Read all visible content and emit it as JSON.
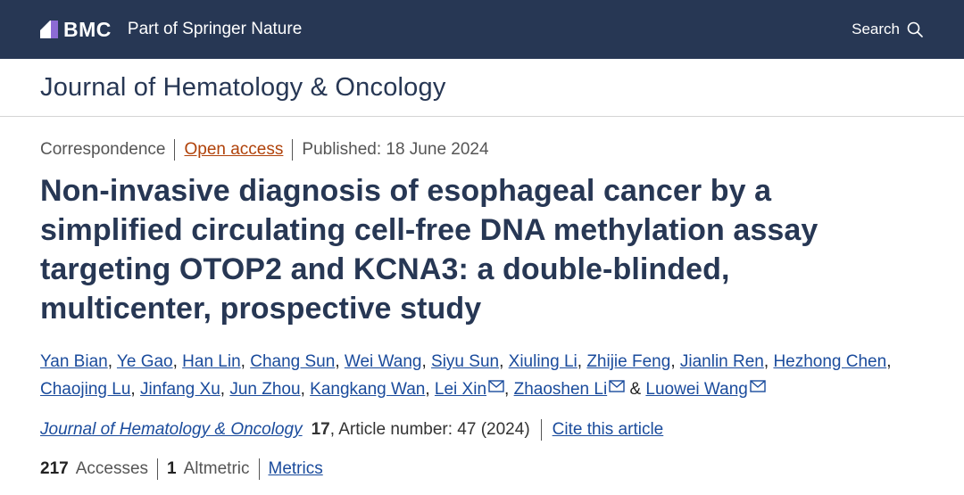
{
  "header": {
    "logo_text": "BMC",
    "tagline": "Part of Springer Nature",
    "search_label": "Search",
    "search_icon": "search-icon"
  },
  "journal": {
    "title": "Journal of Hematology & Oncology"
  },
  "article": {
    "type": "Correspondence",
    "access": "Open access",
    "published": "Published: 18 June 2024",
    "title": "Non-invasive diagnosis of esophageal cancer by a simplified circulating cell-free DNA methylation assay targeting OTOP2 and KCNA3: a double-blinded, multicenter, prospective study",
    "authors": [
      {
        "name": "Yan Bian",
        "after": ", "
      },
      {
        "name": "Ye Gao",
        "after": ", "
      },
      {
        "name": "Han Lin",
        "after": ", "
      },
      {
        "name": "Chang Sun",
        "after": ", "
      },
      {
        "name": "Wei Wang",
        "after": ", "
      },
      {
        "name": "Siyu Sun",
        "after": ", "
      },
      {
        "name": "Xiuling Li",
        "after": ", "
      },
      {
        "name": "Zhijie Feng",
        "after": ", "
      },
      {
        "name": "Jianlin Ren",
        "after": ", "
      },
      {
        "name": "Hezhong Chen",
        "after": ", "
      },
      {
        "name": "Chaojing Lu",
        "after": ", "
      },
      {
        "name": "Jinfang Xu",
        "after": ", "
      },
      {
        "name": "Jun Zhou",
        "after": ", "
      },
      {
        "name": "Kangkang Wan",
        "after": ", "
      },
      {
        "name": "Lei Xin",
        "after": ", ",
        "email": true
      },
      {
        "name": "Zhaoshen Li",
        "after": " & ",
        "email": true
      },
      {
        "name": "Luowei Wang",
        "after": "",
        "email": true
      }
    ],
    "citation": {
      "journal": "Journal of Hematology & Oncology",
      "volume": "17",
      "article_number": ", Article number: 47 (2024)",
      "cite_label": "Cite this article"
    },
    "metrics": {
      "accesses_count": "217",
      "accesses_label": "Accesses",
      "altmetric_count": "1",
      "altmetric_label": "Altmetric",
      "metrics_link": "Metrics"
    }
  },
  "colors": {
    "header_bg": "#273754",
    "title": "#273754",
    "link": "#1a4b9c",
    "open_access": "#b0420a"
  }
}
